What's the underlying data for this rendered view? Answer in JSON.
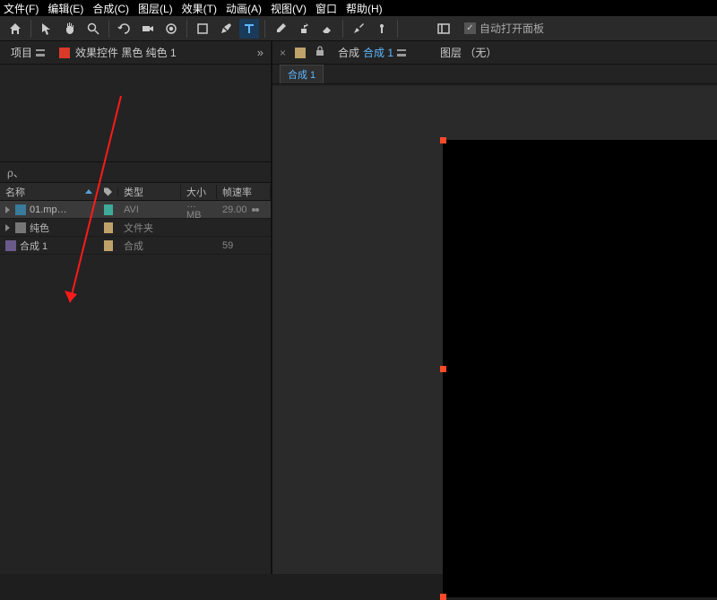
{
  "menu": [
    "文件(F)",
    "编辑(E)",
    "合成(C)",
    "图层(L)",
    "效果(T)",
    "动画(A)",
    "视图(V)",
    "窗口",
    "帮助(H)"
  ],
  "toolbar": {
    "auto_open_panel_label": "自动打开面板"
  },
  "project_panel": {
    "tab_label": "项目",
    "effects_tab_label": "效果控件 黑色 纯色 1",
    "search_placeholder": "ρ、",
    "columns": {
      "name": "名称",
      "type": "类型",
      "size": "大小",
      "rate": "帧速率"
    },
    "rows": [
      {
        "name": "01.mp…",
        "type": "AVI",
        "size": "… MB",
        "rate": "29.00",
        "icon": "video",
        "tag": "teal"
      },
      {
        "name": "纯色",
        "type": "文件夹",
        "size": "",
        "rate": "",
        "icon": "folder",
        "tag": "tan"
      },
      {
        "name": "合成 1",
        "type": "合成",
        "size": "",
        "rate": "59",
        "icon": "comp",
        "tag": "tan"
      }
    ]
  },
  "viewer_panel": {
    "comp_label_prefix": "合成",
    "comp_name": "合成 1",
    "layer_label": "图层 （无）",
    "subtab": "合成 1"
  }
}
